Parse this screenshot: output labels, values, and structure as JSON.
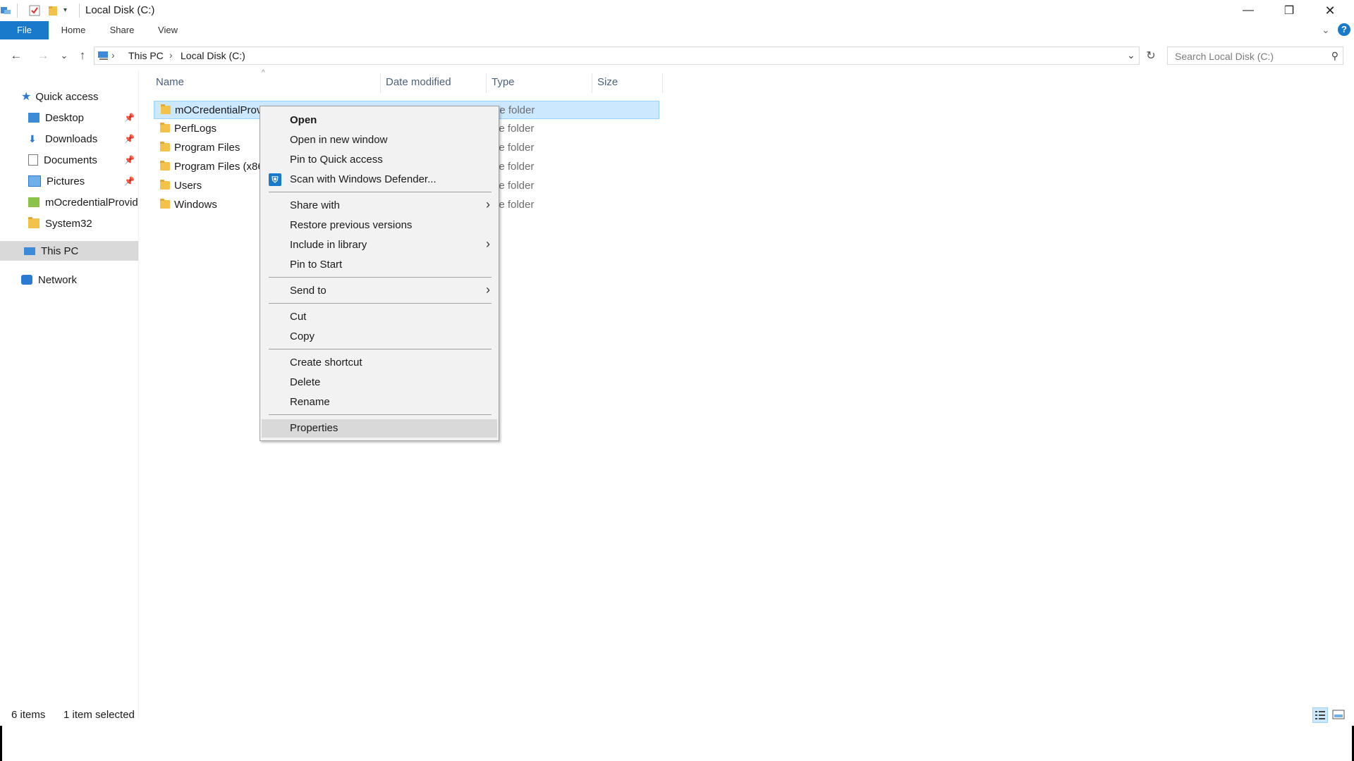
{
  "window": {
    "title": "Local Disk (C:)",
    "controls": {
      "minimize": "—",
      "maximize": "❐",
      "close": "✕"
    }
  },
  "ribbon": {
    "tabs": [
      "File",
      "Home",
      "Share",
      "View"
    ],
    "expand_glyph": "⌄",
    "help_glyph": "?"
  },
  "address": {
    "back": "←",
    "forward": "→",
    "recent": "⌄",
    "up": "↑",
    "crumbs": [
      "This PC",
      "Local Disk (C:)"
    ],
    "separator": "›",
    "dropdown": "⌄",
    "refresh": "↻",
    "search_placeholder": "Search Local Disk (C:)",
    "search_glyph": "⚲"
  },
  "nav": {
    "quick_access": "Quick access",
    "items": [
      {
        "label": "Desktop",
        "pinned": true
      },
      {
        "label": "Downloads",
        "pinned": true
      },
      {
        "label": "Documents",
        "pinned": true
      },
      {
        "label": "Pictures",
        "pinned": true
      },
      {
        "label": "mOcredentialProvid",
        "pinned": false
      },
      {
        "label": "System32",
        "pinned": false
      }
    ],
    "this_pc": "This PC",
    "network": "Network",
    "pin_glyph": "📌"
  },
  "columns": {
    "name": "Name",
    "date": "Date modified",
    "type": "Type",
    "size": "Size",
    "sort_glyph": "^"
  },
  "files": [
    {
      "name": "mOCredentialProv",
      "type": "le folder",
      "selected": true
    },
    {
      "name": "PerfLogs",
      "type": "le folder",
      "selected": false
    },
    {
      "name": "Program Files",
      "type": "le folder",
      "selected": false
    },
    {
      "name": "Program Files (x86",
      "type": "le folder",
      "selected": false
    },
    {
      "name": "Users",
      "type": "le folder",
      "selected": false
    },
    {
      "name": "Windows",
      "type": "le folder",
      "selected": false
    }
  ],
  "context_menu": {
    "open": "Open",
    "open_new_window": "Open in new window",
    "pin_quick_access": "Pin to Quick access",
    "scan_defender": "Scan with Windows Defender...",
    "share_with": "Share with",
    "restore_versions": "Restore previous versions",
    "include_library": "Include in library",
    "pin_start": "Pin to Start",
    "send_to": "Send to",
    "cut": "Cut",
    "copy": "Copy",
    "create_shortcut": "Create shortcut",
    "delete": "Delete",
    "rename": "Rename",
    "properties": "Properties",
    "submenu_arrow": "›"
  },
  "status": {
    "items": "6 items",
    "selected": "1 item selected"
  },
  "colors": {
    "accent": "#1979ca",
    "selection": "#cce8ff",
    "folder": "#f3c24a"
  }
}
